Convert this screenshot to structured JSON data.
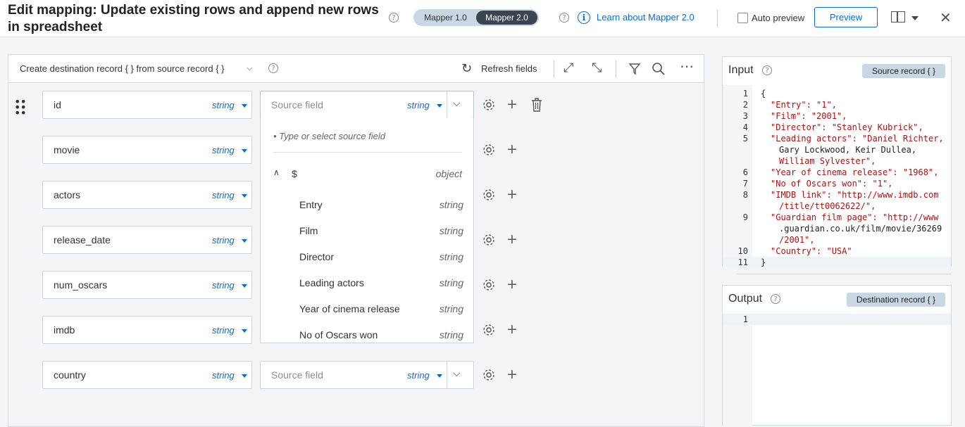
{
  "header": {
    "title": "Edit mapping: Update existing rows and append new rows in spreadsheet",
    "mapper_v1": "Mapper 1.0",
    "mapper_v2": "Mapper 2.0",
    "learn_link": "Learn about Mapper 2.0",
    "auto_preview": "Auto preview",
    "preview_button": "Preview",
    "help": "?",
    "info": "i",
    "close": "✕"
  },
  "toolbar": {
    "label": "Create destination record { } from source record { }",
    "refresh": "Refresh fields"
  },
  "mappings": [
    {
      "dest": "id",
      "type": "string",
      "source_placeholder": "Source field",
      "source_type": "string"
    },
    {
      "dest": "movie",
      "type": "string"
    },
    {
      "dest": "actors",
      "type": "string"
    },
    {
      "dest": "release_date",
      "type": "string"
    },
    {
      "dest": "num_oscars",
      "type": "string"
    },
    {
      "dest": "imdb",
      "type": "string"
    },
    {
      "dest": "country",
      "type": "string",
      "source_placeholder": "Source field",
      "source_type": "string"
    }
  ],
  "dropdown": {
    "hint": "• Type or select source field",
    "root": "$",
    "root_type": "object",
    "items": [
      {
        "label": "Entry",
        "type": "string"
      },
      {
        "label": "Film",
        "type": "string"
      },
      {
        "label": "Director",
        "type": "string"
      },
      {
        "label": "Leading actors",
        "type": "string"
      },
      {
        "label": "Year of cinema release",
        "type": "string"
      },
      {
        "label": "No of Oscars won",
        "type": "string"
      }
    ]
  },
  "input_panel": {
    "title": "Input",
    "badge": "Source record { }",
    "line_numbers": [
      "1",
      "2",
      "3",
      "4",
      "5",
      "",
      "",
      "6",
      "7",
      "8",
      "",
      "9",
      "",
      "",
      "10",
      "11"
    ],
    "lines": [
      {
        "key": "",
        "rest": "{"
      },
      {
        "key": "\"Entry\"",
        "rest": ": \"1\","
      },
      {
        "key": "\"Film\"",
        "rest": ": \"2001\","
      },
      {
        "key": "\"Director\"",
        "rest": ": \"Stanley Kubrick\","
      },
      {
        "key": "\"Leading actors\"",
        "rest": ": \"Daniel Richter,"
      },
      {
        "key": "",
        "rest": "Gary Lockwood, Keir Dullea,"
      },
      {
        "key": "",
        "rest": "William Sylvester\","
      },
      {
        "key": "\"Year of cinema release\"",
        "rest": ": \"1968\","
      },
      {
        "key": "\"No of Oscars won\"",
        "rest": ": \"1\","
      },
      {
        "key": "\"IMDB link\"",
        "rest": ": \"http://www.imdb.com"
      },
      {
        "key": "",
        "rest": "/title/tt0062622/\","
      },
      {
        "key": "\"Guardian film page\"",
        "rest": ": \"http://www"
      },
      {
        "key": "",
        "rest": ".guardian.co.uk/film/movie/36269"
      },
      {
        "key": "",
        "rest": "/2001\","
      },
      {
        "key": "\"Country\"",
        "rest": ": \"USA\""
      },
      {
        "key": "",
        "rest": "}"
      }
    ]
  },
  "output_panel": {
    "title": "Output",
    "badge": "Destination record { }",
    "line_numbers": [
      "1"
    ]
  }
}
